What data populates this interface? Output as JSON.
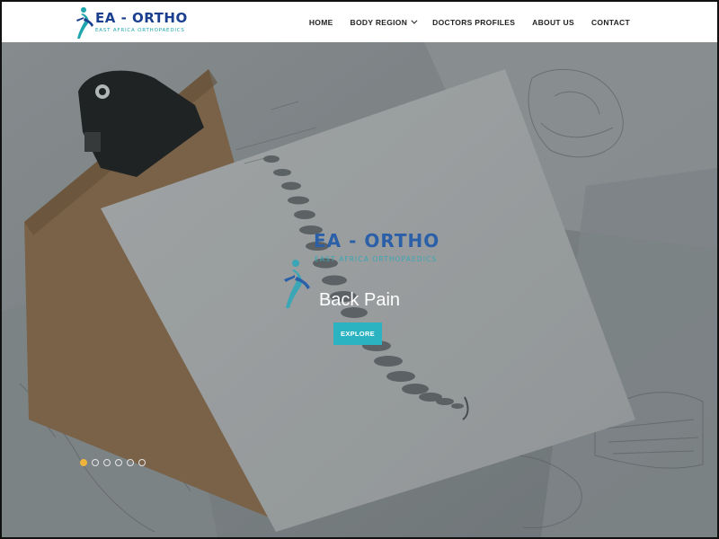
{
  "brand": {
    "name": "EA - ORTHO",
    "tagline": "EAST AFRICA ORTHOPAEDICS"
  },
  "nav": {
    "items": [
      {
        "label": "HOME",
        "has_dropdown": false
      },
      {
        "label": "BODY REGION",
        "has_dropdown": true
      },
      {
        "label": "DOCTORS PROFILES",
        "has_dropdown": false
      },
      {
        "label": "ABOUT US",
        "has_dropdown": false
      },
      {
        "label": "CONTACT",
        "has_dropdown": false
      }
    ]
  },
  "hero": {
    "logo_text": "EA - ORTHO",
    "logo_sub": "EAST AFRICA ORTHOPAEDICS",
    "title": "Back Pain",
    "button_label": "EXPLORE",
    "slides_count": 6,
    "active_slide": 1
  },
  "colors": {
    "brand_blue": "#1b3f8f",
    "brand_teal": "#1fa6ad",
    "button": "#2cb3c2",
    "active_dot": "#f0b43c"
  },
  "icons": {
    "chevron": "chevron-down-icon",
    "logo_figure": "person-figure-icon"
  }
}
